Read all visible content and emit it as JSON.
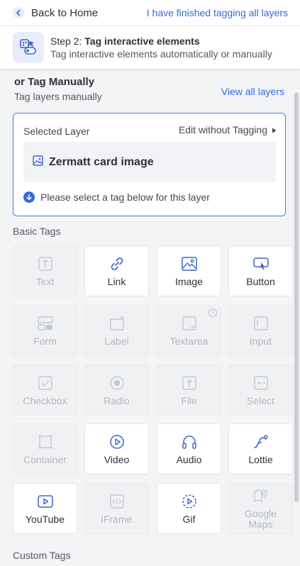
{
  "header": {
    "back_label": "Back to Home",
    "finish_label": "I have finished tagging all layers"
  },
  "step": {
    "prefix": "Step 2: ",
    "title": "Tag interactive elements",
    "subtitle": "Tag interactive elements automatically or manually"
  },
  "manual": {
    "title": "or Tag Manually",
    "subtitle": "Tag layers manually",
    "view_all_label": "View all layers"
  },
  "selected": {
    "label": "Selected Layer",
    "edit_label": "Edit without Tagging",
    "layer_name": "Zermatt card image",
    "hint": "Please select a tag below for this layer"
  },
  "basic_tags": {
    "title": "Basic Tags",
    "items": [
      {
        "label": "Text",
        "icon": "text-icon",
        "enabled": false
      },
      {
        "label": "Link",
        "icon": "link-icon",
        "enabled": true
      },
      {
        "label": "Image",
        "icon": "image-icon",
        "enabled": true
      },
      {
        "label": "Button",
        "icon": "button-icon",
        "enabled": true
      },
      {
        "label": "Form",
        "icon": "form-icon",
        "enabled": false
      },
      {
        "label": "Label",
        "icon": "label-icon",
        "enabled": false
      },
      {
        "label": "Textarea",
        "icon": "textarea-icon",
        "enabled": false
      },
      {
        "label": "Input",
        "icon": "input-icon",
        "enabled": false
      },
      {
        "label": "Checkbox",
        "icon": "checkbox-icon",
        "enabled": false
      },
      {
        "label": "Radio",
        "icon": "radio-icon",
        "enabled": false
      },
      {
        "label": "File",
        "icon": "file-icon",
        "enabled": false
      },
      {
        "label": "Select",
        "icon": "select-icon",
        "enabled": false
      },
      {
        "label": "Container",
        "icon": "container-icon",
        "enabled": false
      },
      {
        "label": "Video",
        "icon": "video-icon",
        "enabled": true
      },
      {
        "label": "Audio",
        "icon": "audio-icon",
        "enabled": true
      },
      {
        "label": "Lottie",
        "icon": "lottie-icon",
        "enabled": true
      },
      {
        "label": "YouTube",
        "icon": "youtube-icon",
        "enabled": true
      },
      {
        "label": "iFrame",
        "icon": "iframe-icon",
        "enabled": false
      },
      {
        "label": "Gif",
        "icon": "gif-icon",
        "enabled": true
      },
      {
        "label": "Google Maps",
        "icon": "google-maps-icon",
        "enabled": false
      }
    ]
  },
  "custom_tags": {
    "title": "Custom Tags"
  },
  "colors": {
    "accent": "#3569e0",
    "enabled_icon": "#3b63c9",
    "disabled_icon": "#c3c9d3"
  }
}
